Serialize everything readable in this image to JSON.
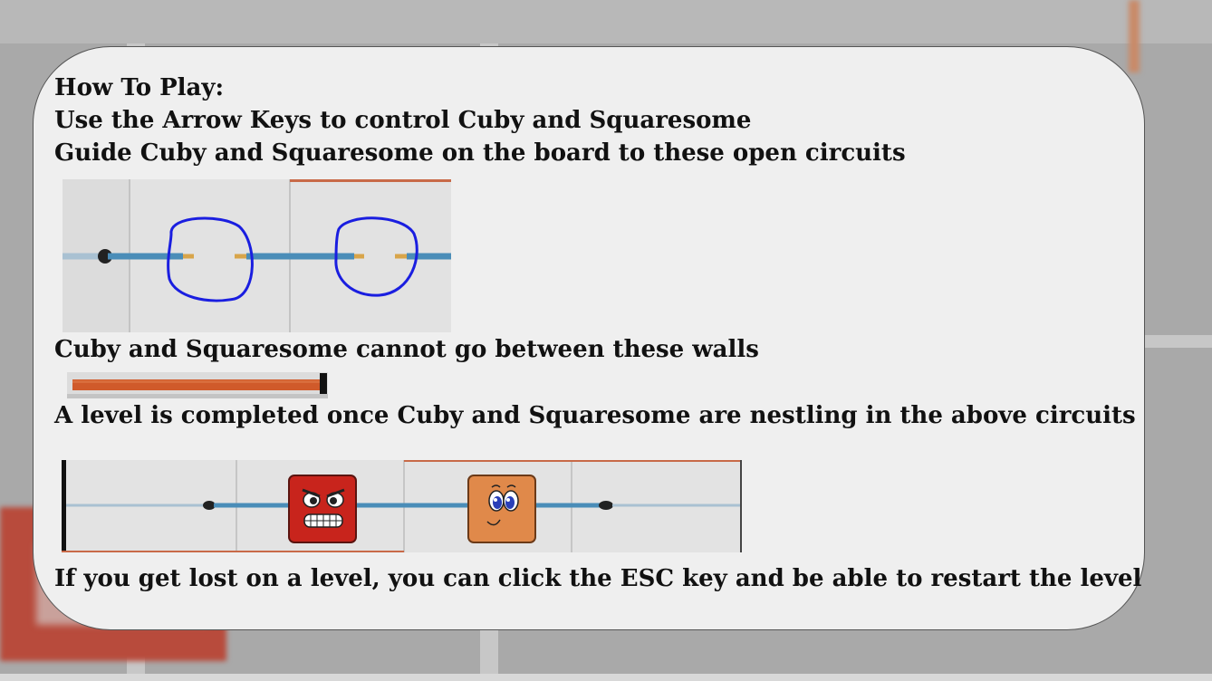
{
  "instructions": {
    "heading": "How To Play:",
    "line_controls": "Use the Arrow Keys to control Cuby and Squaresome",
    "line_guide": "Guide Cuby and Squaresome on the board to these open circuits",
    "line_walls": "Cuby and Squaresome cannot go between these walls",
    "line_complete": "A level is completed once Cuby and Squaresome are nestling in the above circuits",
    "line_esc": "If you get lost on a level, you can click the ESC key and be able to restart the level"
  },
  "images": {
    "open_circuits": "open-circuit-example",
    "wall": "wall-example",
    "characters": [
      "Cuby",
      "Squaresome"
    ]
  },
  "colors": {
    "panel_bg": "#efefef",
    "circuit_wire": "#4a8db8",
    "highlight_circle": "#1a1ee0",
    "wall_orange": "#d05a2a",
    "cuby_red": "#c8241c",
    "squaresome_orange": "#e0894a"
  }
}
